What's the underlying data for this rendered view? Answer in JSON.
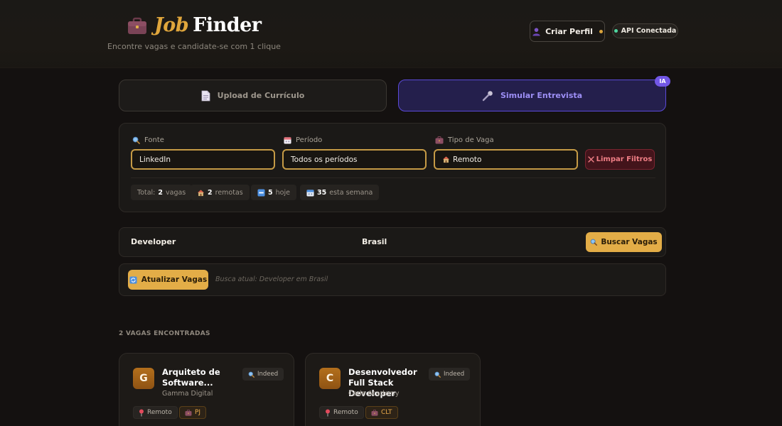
{
  "header": {
    "logo_word1": "Job",
    "logo_word2": "Finder",
    "tagline": "Encontre vagas e candidate-se com 1 clique",
    "profile_button": "Criar Perfil",
    "api_status": "API Conectada"
  },
  "tabs": [
    {
      "label": "Upload de Currículo",
      "icon": "document-icon"
    },
    {
      "label": "Simular Entrevista",
      "icon": "microphone-icon",
      "badge": "IA"
    }
  ],
  "filters": {
    "source": {
      "label": "Fonte",
      "value": "LinkedIn"
    },
    "period": {
      "label": "Período",
      "value": "Todos os períodos"
    },
    "job_type": {
      "label": "Tipo de Vaga",
      "value": "Remoto"
    },
    "clear_button": "Limpar Filtros"
  },
  "stats": {
    "total_label": "Total:",
    "total_value": "2",
    "total_unit": "vagas",
    "remote_value": "2",
    "remote_unit": "remotas",
    "today_value": "5",
    "today_unit": "hoje",
    "week_value": "35",
    "week_unit": "esta semana"
  },
  "search": {
    "role": "Developer",
    "location": "Brasil",
    "button": "Buscar Vagas"
  },
  "refresh": {
    "button": "Atualizar Vagas",
    "current": "Busca atual: Developer em Brasil"
  },
  "results": {
    "count_label": "2 VAGAS ENCONTRADAS",
    "jobs": [
      {
        "initial": "G",
        "title": "Arquiteto de Software...",
        "company": "Gamma Digital",
        "source": "Indeed",
        "location": "Remoto",
        "contract": "PJ"
      },
      {
        "initial": "C",
        "title": "Desenvolvedor Full Stack Developer",
        "company": "Code Academy",
        "source": "Indeed",
        "location": "Remoto",
        "contract": "CLT"
      }
    ]
  },
  "colors": {
    "accent": "#e3ad47",
    "background": "#141110",
    "interview_tab": "#5b4ad8",
    "api_ok": "#4fd7a0",
    "clear_button": "#43141b"
  }
}
